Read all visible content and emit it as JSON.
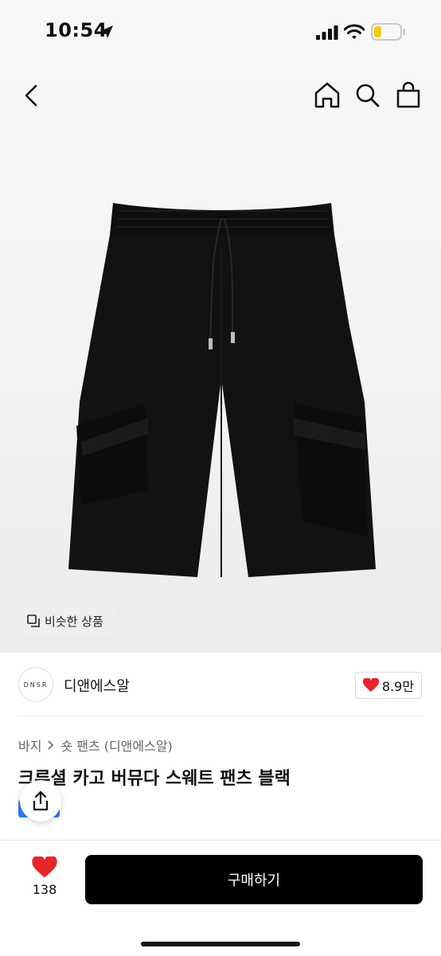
{
  "status_bar": {
    "time": "10:54"
  },
  "nav": {
    "back": "back",
    "home": "home",
    "search": "search",
    "bag": "bag"
  },
  "similar_chip": {
    "label": "비슷한 상품"
  },
  "brand": {
    "logo_text": "DNSR",
    "name": "디앤에스알",
    "likes": "8.9만"
  },
  "breadcrumb": {
    "category": "바지",
    "subcategory": "숏 팬츠",
    "brand_note": "(디앤에스알)"
  },
  "product": {
    "title": "크루셜 카고 버뮤다 스웨트 팬츠 블랙"
  },
  "bottom_bar": {
    "wish_count": "138",
    "buy_label": "구매하기"
  },
  "colors": {
    "accent_red": "#e8252b",
    "buy_button": "#000000",
    "tag_blue": "#2d7ff0"
  },
  "icons": [
    "location-arrow-icon",
    "signal-icon",
    "wifi-icon",
    "battery-icon",
    "back-icon",
    "home-icon",
    "search-icon",
    "bag-icon",
    "similar-icon",
    "heart-icon",
    "share-icon"
  ]
}
